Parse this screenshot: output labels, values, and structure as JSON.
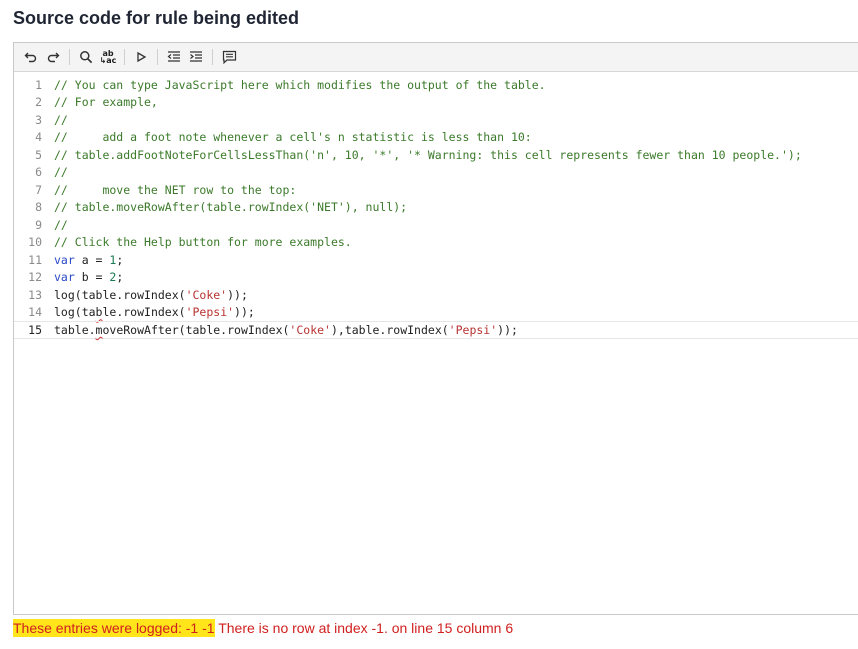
{
  "page": {
    "title": "Source code for rule being edited"
  },
  "toolbar": {
    "buttons": [
      {
        "name": "undo-icon"
      },
      {
        "name": "redo-icon"
      },
      {
        "name": "search-icon"
      },
      {
        "name": "replace-icon",
        "label_top": "ab",
        "label_bottom": "ac"
      },
      {
        "name": "run-icon"
      },
      {
        "name": "outdent-icon"
      },
      {
        "name": "indent-icon"
      },
      {
        "name": "comment-icon"
      }
    ]
  },
  "editor": {
    "lines": [
      {
        "n": "1",
        "text": "// You can type JavaScript here which modifies the output of the table."
      },
      {
        "n": "2",
        "text": "// For example,"
      },
      {
        "n": "3",
        "text": "//"
      },
      {
        "n": "4",
        "text": "//     add a foot note whenever a cell's n statistic is less than 10:"
      },
      {
        "n": "5",
        "text": "// table.addFootNoteForCellsLessThan('n', 10, '*', '* Warning: this cell represents fewer than 10 people.');"
      },
      {
        "n": "6",
        "text": "//"
      },
      {
        "n": "7",
        "text": "//     move the NET row to the top:"
      },
      {
        "n": "8",
        "text": "// table.moveRowAfter(table.rowIndex('NET'), null);"
      },
      {
        "n": "9",
        "text": "//"
      },
      {
        "n": "10",
        "text": "// Click the Help button for more examples."
      },
      {
        "n": "11",
        "kw": "var",
        "rest": " a = ",
        "num": "1",
        "end": ";"
      },
      {
        "n": "12",
        "kw": "var",
        "rest": " b = ",
        "num": "2",
        "end": ";"
      },
      {
        "n": "13",
        "a": "log(table.rowIndex(",
        "s1": "'Coke'",
        "b": "));"
      },
      {
        "n": "14",
        "a1": "log(ta",
        "sq": "b",
        "a2": "le.rowIndex(",
        "s1": "'Pepsi'",
        "b": "));"
      },
      {
        "n": "15",
        "a1": "table.",
        "sq": "m",
        "a2": "oveRowAfter(table.rowIndex(",
        "s1": "'Coke'",
        "m": "),table.rowIndex(",
        "s2": "'Pepsi'",
        "b": "));"
      }
    ]
  },
  "status": {
    "logged": "These entries were logged: -1 -1",
    "error": " There is no row at index -1. on line 15 column 6"
  },
  "colors": {
    "comment": "#3b7a2a",
    "keyword": "#2a49c7",
    "string": "#b83232",
    "error": "#d0201f",
    "highlight": "#ffe51a"
  }
}
